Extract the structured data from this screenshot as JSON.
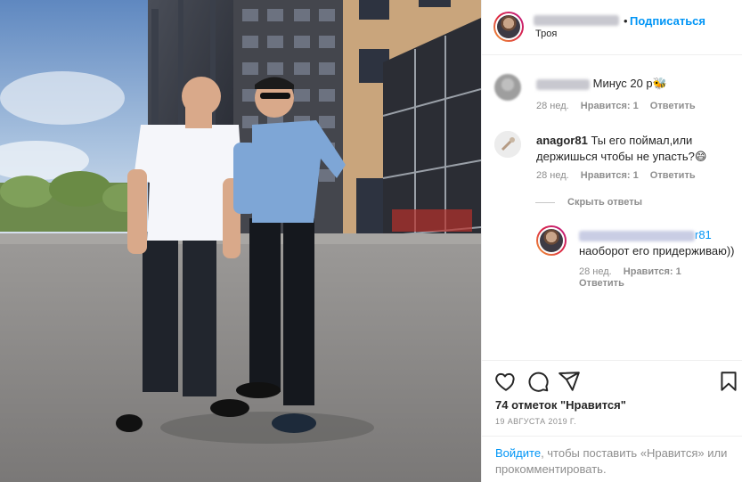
{
  "header": {
    "follow_label": "Подписаться",
    "separator": "•",
    "location": "Троя"
  },
  "comments": [
    {
      "text": "Минус 20 р🐝",
      "time": "28 нед.",
      "likes": "Нравится: 1",
      "reply": "Ответить"
    },
    {
      "username": "anagor81",
      "text": "Ты его поймал,или держишься чтобы не упасть?😄",
      "time": "28 нед.",
      "likes": "Нравится: 1",
      "reply": "Ответить"
    }
  ],
  "hide_replies_label": "Скрыть ответы",
  "reply": {
    "username_suffix": "r81",
    "text": "наоборот его придерживаю))",
    "time": "28 нед.",
    "likes": "Нравится: 1",
    "reply": "Ответить"
  },
  "actions": {
    "icons": [
      "heart-icon",
      "comment-icon",
      "share-icon",
      "bookmark-icon"
    ],
    "likes_count": "74 отметок \"Нравится\"",
    "date": "19 АВГУСТА 2019 Г."
  },
  "login_bar": {
    "login_link": "Войдите",
    "text": ", чтобы поставить «Нравится» или прокомментировать."
  },
  "colors": {
    "accent": "#0095f6",
    "muted": "#8e8e8e",
    "text": "#262626"
  }
}
